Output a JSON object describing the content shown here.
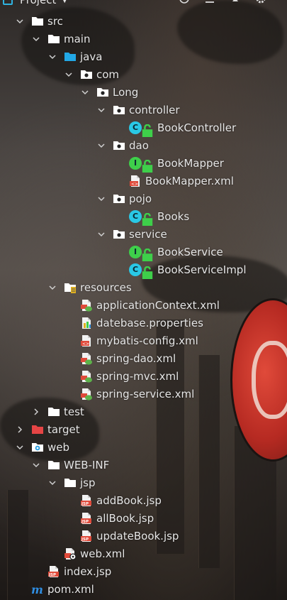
{
  "header": {
    "title": "Project",
    "caret": "▼"
  },
  "colors": {
    "folder": "#ffffff",
    "source_folder": "#22a8e6",
    "excluded_folder": "#e64545",
    "class_badge": "#29c8e6",
    "interface_badge": "#3ecf4a",
    "xml_red": "#e04a3a",
    "spring_green": "#5db24a",
    "maven": "#2f8de0"
  },
  "tree": [
    {
      "label": "src",
      "depth": 0,
      "expanded": true,
      "icon": "folder-icon"
    },
    {
      "label": "main",
      "depth": 1,
      "expanded": true,
      "icon": "folder-icon"
    },
    {
      "label": "java",
      "depth": 2,
      "expanded": true,
      "icon": "source-folder-icon"
    },
    {
      "label": "com",
      "depth": 3,
      "expanded": true,
      "icon": "package-icon"
    },
    {
      "label": "Long",
      "depth": 4,
      "expanded": true,
      "icon": "package-icon"
    },
    {
      "label": "controller",
      "depth": 5,
      "expanded": true,
      "icon": "package-icon"
    },
    {
      "label": "BookController",
      "depth": 6,
      "icon": "class-icon"
    },
    {
      "label": "dao",
      "depth": 5,
      "expanded": true,
      "icon": "package-icon"
    },
    {
      "label": "BookMapper",
      "depth": 6,
      "icon": "interface-icon"
    },
    {
      "label": "BookMapper.xml",
      "depth": 6,
      "icon": "mybatis-xml-icon"
    },
    {
      "label": "pojo",
      "depth": 5,
      "expanded": true,
      "icon": "package-icon"
    },
    {
      "label": "Books",
      "depth": 6,
      "icon": "class-icon"
    },
    {
      "label": "service",
      "depth": 5,
      "expanded": true,
      "icon": "package-icon"
    },
    {
      "label": "BookService",
      "depth": 6,
      "icon": "interface-icon"
    },
    {
      "label": "BookServiceImpl",
      "depth": 6,
      "icon": "class-icon"
    },
    {
      "label": "resources",
      "depth": 2,
      "expanded": true,
      "icon": "resources-folder-icon"
    },
    {
      "label": "applicationContext.xml",
      "depth": 3,
      "icon": "spring-xml-icon"
    },
    {
      "label": "datebase.properties",
      "depth": 3,
      "icon": "properties-icon"
    },
    {
      "label": "mybatis-config.xml",
      "depth": 3,
      "icon": "mybatis-xml-icon"
    },
    {
      "label": "spring-dao.xml",
      "depth": 3,
      "icon": "spring-xml-icon"
    },
    {
      "label": "spring-mvc.xml",
      "depth": 3,
      "icon": "spring-xml-icon"
    },
    {
      "label": "spring-service.xml",
      "depth": 3,
      "icon": "spring-xml-icon"
    },
    {
      "label": "test",
      "depth": 1,
      "expanded": false,
      "icon": "folder-icon"
    },
    {
      "label": "target",
      "depth": 0,
      "expanded": false,
      "icon": "excluded-folder-icon"
    },
    {
      "label": "web",
      "depth": 0,
      "expanded": true,
      "icon": "web-folder-icon"
    },
    {
      "label": "WEB-INF",
      "depth": 1,
      "expanded": true,
      "icon": "folder-icon"
    },
    {
      "label": "jsp",
      "depth": 2,
      "expanded": true,
      "icon": "folder-icon"
    },
    {
      "label": "addBook.jsp",
      "depth": 3,
      "icon": "jsp-icon"
    },
    {
      "label": "allBook.jsp",
      "depth": 3,
      "icon": "jsp-icon"
    },
    {
      "label": "updateBook.jsp",
      "depth": 3,
      "icon": "jsp-icon"
    },
    {
      "label": "web.xml",
      "depth": 2,
      "icon": "webxml-icon"
    },
    {
      "label": "index.jsp",
      "depth": 1,
      "icon": "jsp-icon"
    },
    {
      "label": "pom.xml",
      "depth": 0,
      "icon": "maven-icon"
    }
  ]
}
